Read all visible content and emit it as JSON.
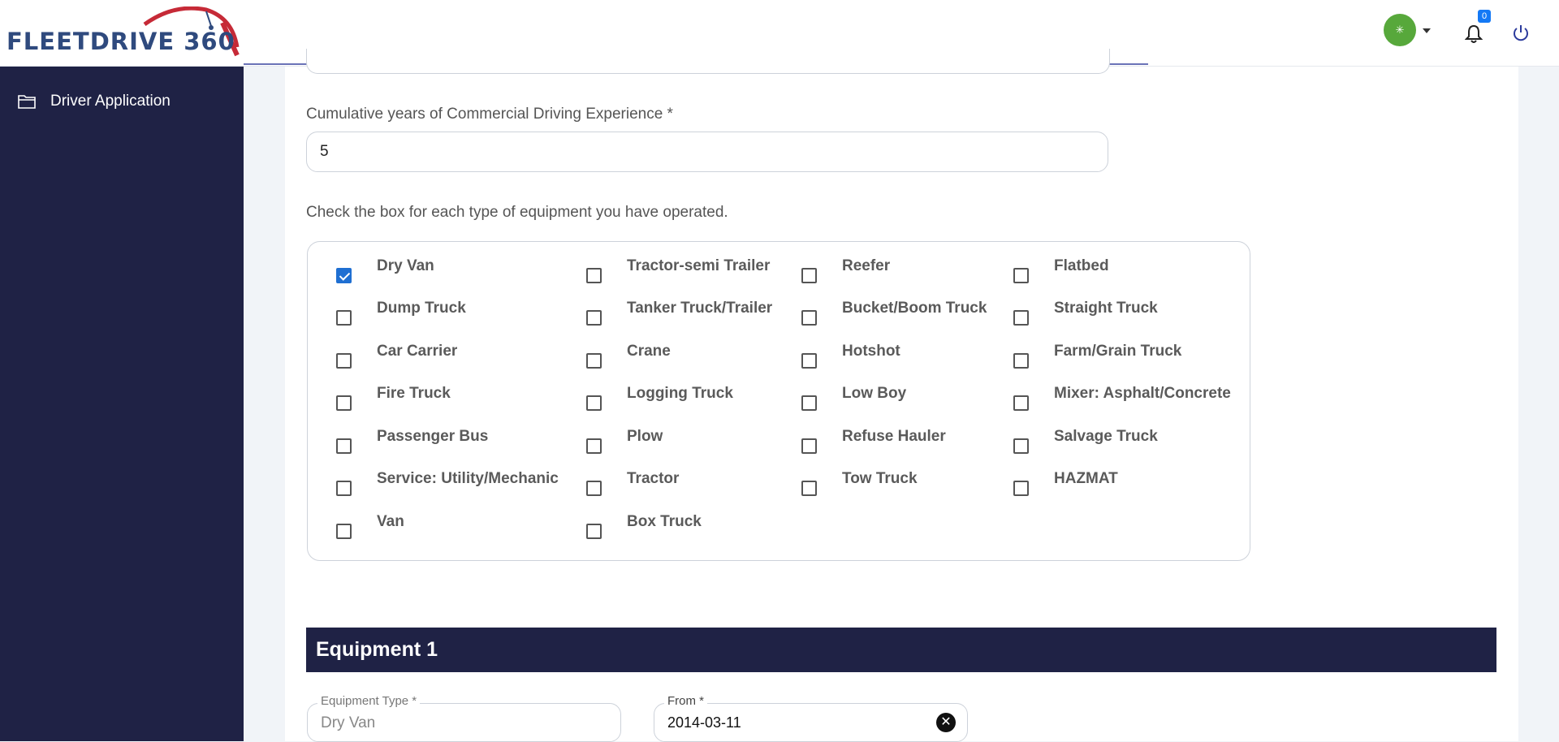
{
  "header": {
    "logo_text": "FLEETDRIVE 360",
    "avatar_glyph": "✳",
    "notification_count": "0",
    "icons": [
      "speedometer-icon",
      "chevron-down-icon",
      "bell-icon",
      "power-icon"
    ]
  },
  "sidebar": {
    "items": [
      {
        "label": "Driver Application",
        "icon": "folder-icon"
      }
    ]
  },
  "form": {
    "experience_label": "Cumulative years of Commercial Driving Experience *",
    "experience_value": "5",
    "equipment_instruction": "Check the box for each type of equipment you have operated.",
    "equipment_options": [
      {
        "label": "Dry Van",
        "checked": true
      },
      {
        "label": "Tractor-semi Trailer",
        "checked": false
      },
      {
        "label": "Reefer",
        "checked": false
      },
      {
        "label": "Flatbed",
        "checked": false
      },
      {
        "label": "Dump Truck",
        "checked": false
      },
      {
        "label": "Tanker Truck/Trailer",
        "checked": false
      },
      {
        "label": "Bucket/Boom Truck",
        "checked": false
      },
      {
        "label": "Straight Truck",
        "checked": false
      },
      {
        "label": "Car Carrier",
        "checked": false
      },
      {
        "label": "Crane",
        "checked": false
      },
      {
        "label": "Hotshot",
        "checked": false
      },
      {
        "label": "Farm/Grain Truck",
        "checked": false
      },
      {
        "label": "Fire Truck",
        "checked": false
      },
      {
        "label": "Logging Truck",
        "checked": false
      },
      {
        "label": "Low Boy",
        "checked": false
      },
      {
        "label": "Mixer: Asphalt/Concrete",
        "checked": false
      },
      {
        "label": "Passenger Bus",
        "checked": false
      },
      {
        "label": "Plow",
        "checked": false
      },
      {
        "label": "Refuse Hauler",
        "checked": false
      },
      {
        "label": "Salvage Truck",
        "checked": false
      },
      {
        "label": "Service: Utility/Mechanic",
        "checked": false
      },
      {
        "label": "Tractor",
        "checked": false
      },
      {
        "label": "Tow Truck",
        "checked": false
      },
      {
        "label": "HAZMAT",
        "checked": false
      },
      {
        "label": "Van",
        "checked": false
      },
      {
        "label": "Box Truck",
        "checked": false
      }
    ]
  },
  "equipment_section": {
    "title": "Equipment 1",
    "equipment_type_label": "Equipment Type *",
    "equipment_type_value": "Dry Van",
    "from_label": "From *",
    "from_value": "2014-03-11",
    "clear_glyph": "✕"
  },
  "colors": {
    "sidebar_bg": "#1f2245",
    "checkbox_checked": "#1f6fd2",
    "avatar": "#57a83b",
    "badge": "#1479f5"
  }
}
